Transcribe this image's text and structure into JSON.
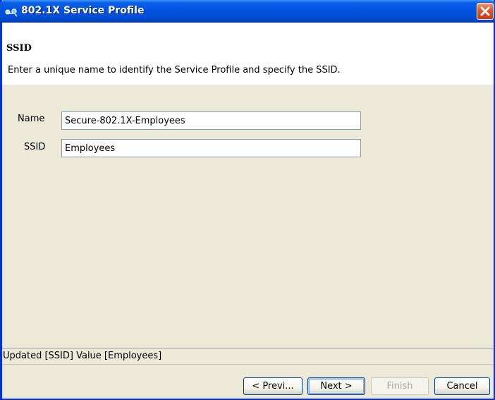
{
  "window": {
    "title": "802.1X Service Profile"
  },
  "header": {
    "title": "SSID",
    "description": "Enter a unique name to identify the Service Profile and specify the SSID."
  },
  "form": {
    "name_label": "Name",
    "name_value": "Secure-802.1X-Employees",
    "ssid_label": "SSID",
    "ssid_value": "Employees"
  },
  "status": {
    "message": "Updated [SSID] Value [Employees]"
  },
  "buttons": {
    "previous": "< Previ...",
    "next": "Next >",
    "finish": "Finish",
    "cancel": "Cancel"
  },
  "icons": {
    "app": "network-icon",
    "close": "close-icon"
  },
  "colors": {
    "titlebar": "#0053e1",
    "close_button": "#e3592e",
    "dialog_background": "#ece9d8",
    "field_border": "#7f9db9"
  }
}
